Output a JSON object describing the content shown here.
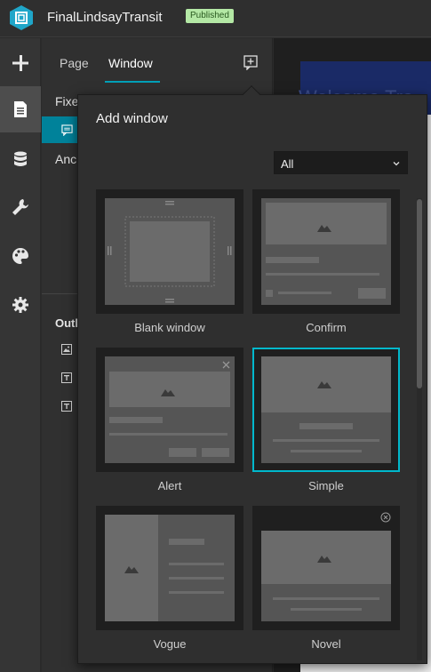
{
  "app": {
    "title": "FinalLindsayTransit",
    "status": "Published",
    "logo_icon": "experience-builder-logo"
  },
  "rail": {
    "items": [
      {
        "icon": "plus-icon",
        "active": false
      },
      {
        "icon": "page-icon",
        "active": true
      },
      {
        "icon": "database-icon",
        "active": false
      },
      {
        "icon": "wrench-icon",
        "active": false
      },
      {
        "icon": "palette-icon",
        "active": false
      },
      {
        "icon": "gear-icon",
        "active": false
      }
    ]
  },
  "panel": {
    "tabs": [
      "Page",
      "Window"
    ],
    "active_tab": "Window",
    "rows": {
      "fixed_label": "Fixe",
      "anchored_label": "Anc"
    },
    "outline_label": "Outl"
  },
  "canvas": {
    "banner_text": "Welcome Tra"
  },
  "popover": {
    "title": "Add window",
    "filter": {
      "value": "All",
      "options": [
        "All"
      ]
    },
    "templates": [
      {
        "label": "Blank window",
        "selected": false
      },
      {
        "label": "Confirm",
        "selected": false
      },
      {
        "label": "Alert",
        "selected": false
      },
      {
        "label": "Simple",
        "selected": true
      },
      {
        "label": "Vogue",
        "selected": false
      },
      {
        "label": "Novel",
        "selected": false
      }
    ]
  },
  "colors": {
    "accent": "#00b8cc",
    "active_row": "#00829a",
    "badge_bg": "#b4e8a5"
  }
}
